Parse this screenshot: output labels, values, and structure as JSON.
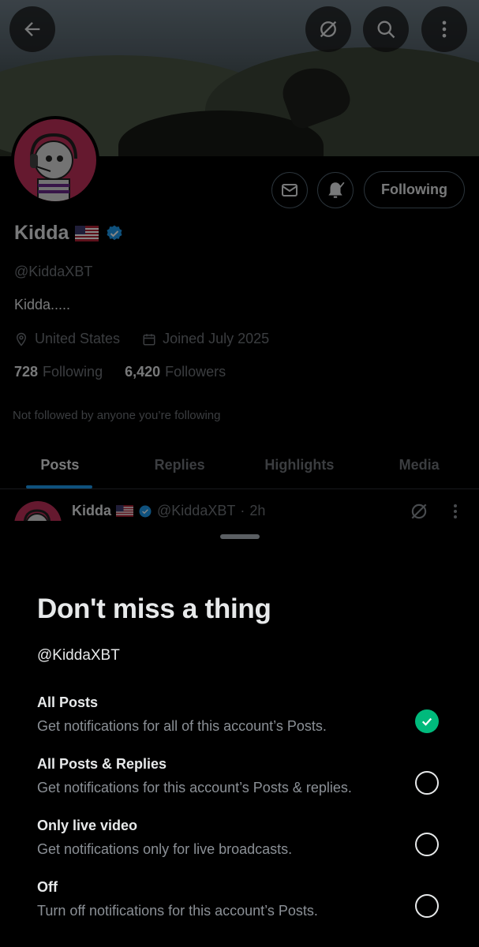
{
  "profile": {
    "name": "Kidda",
    "handle": "@KiddaXBT",
    "bio": "Kidda.....",
    "location": "United States",
    "joined": "Joined July 2025",
    "following_count": "728",
    "following_label": "Following",
    "followers_count": "6,420",
    "followers_label": "Followers",
    "not_followed": "Not followed by anyone you’re following",
    "following_button": "Following"
  },
  "tabs": [
    {
      "label": "Posts",
      "active": true
    },
    {
      "label": "Replies",
      "active": false
    },
    {
      "label": "Highlights",
      "active": false
    },
    {
      "label": "Media",
      "active": false
    }
  ],
  "post": {
    "name": "Kidda",
    "handle": "@KiddaXBT",
    "time": "2h"
  },
  "sheet": {
    "title": "Don't miss a thing",
    "handle": "@KiddaXBT",
    "options": [
      {
        "title": "All Posts",
        "desc": "Get notifications for all of this account’s Posts.",
        "selected": true
      },
      {
        "title": "All Posts & Replies",
        "desc": "Get notifications for this account’s Posts & replies.",
        "selected": false
      },
      {
        "title": "Only live video",
        "desc": "Get notifications only for live broadcasts.",
        "selected": false
      },
      {
        "title": "Off",
        "desc": "Turn off notifications for this account’s Posts.",
        "selected": false
      }
    ]
  },
  "colors": {
    "accent": "#1d9bf0",
    "selected": "#00ba7c",
    "avatar_bg": "#c2305a"
  },
  "icons": {
    "back": "arrow-left-icon",
    "grok": "grok-icon",
    "search": "search-icon",
    "more": "more-vertical-icon",
    "message": "mail-icon",
    "bell": "bell-check-icon",
    "verified": "verified-badge-icon",
    "location": "location-pin-icon",
    "calendar": "calendar-icon",
    "check": "check-icon"
  }
}
